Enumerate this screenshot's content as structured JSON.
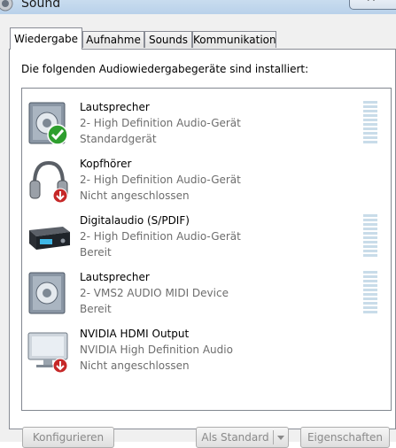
{
  "window": {
    "title": "Sound"
  },
  "tabs": [
    {
      "label": "Wiedergabe",
      "active": true
    },
    {
      "label": "Aufnahme",
      "active": false
    },
    {
      "label": "Sounds",
      "active": false
    },
    {
      "label": "Kommunikation",
      "active": false
    }
  ],
  "instruction": "Die folgenden Audiowiedergabegeräte sind installiert:",
  "devices": [
    {
      "name": "Lautsprecher",
      "description": "2- High Definition Audio-Gerät",
      "status": "Standardgerät",
      "icon": "speaker-icon",
      "badge": "default-checkmark-icon",
      "level_meter": true
    },
    {
      "name": "Kopfhörer",
      "description": "2- High Definition Audio-Gerät",
      "status": "Nicht angeschlossen",
      "icon": "headphones-icon",
      "badge": "disconnected-arrow-icon",
      "level_meter": false
    },
    {
      "name": "Digitalaudio (S/PDIF)",
      "description": "2- High Definition Audio-Gerät",
      "status": "Bereit",
      "icon": "digital-receiver-icon",
      "badge": "",
      "level_meter": true
    },
    {
      "name": "Lautsprecher",
      "description": "2- VMS2 AUDIO MIDI Device",
      "status": "Bereit",
      "icon": "speaker-icon",
      "badge": "",
      "level_meter": true
    },
    {
      "name": "NVIDIA HDMI Output",
      "description": "NVIDIA High Definition Audio",
      "status": "Nicht angeschlossen",
      "icon": "monitor-icon",
      "badge": "disconnected-arrow-icon",
      "level_meter": false
    }
  ],
  "buttons": {
    "configure": "Konfigurieren",
    "set_default": "Als Standard",
    "properties": "Eigenschaften"
  },
  "colors": {
    "default_badge": "#2e9e2e",
    "disconnected_badge": "#c62828",
    "meter": "#c9dce9",
    "disabled_text": "#8a8a8a"
  }
}
